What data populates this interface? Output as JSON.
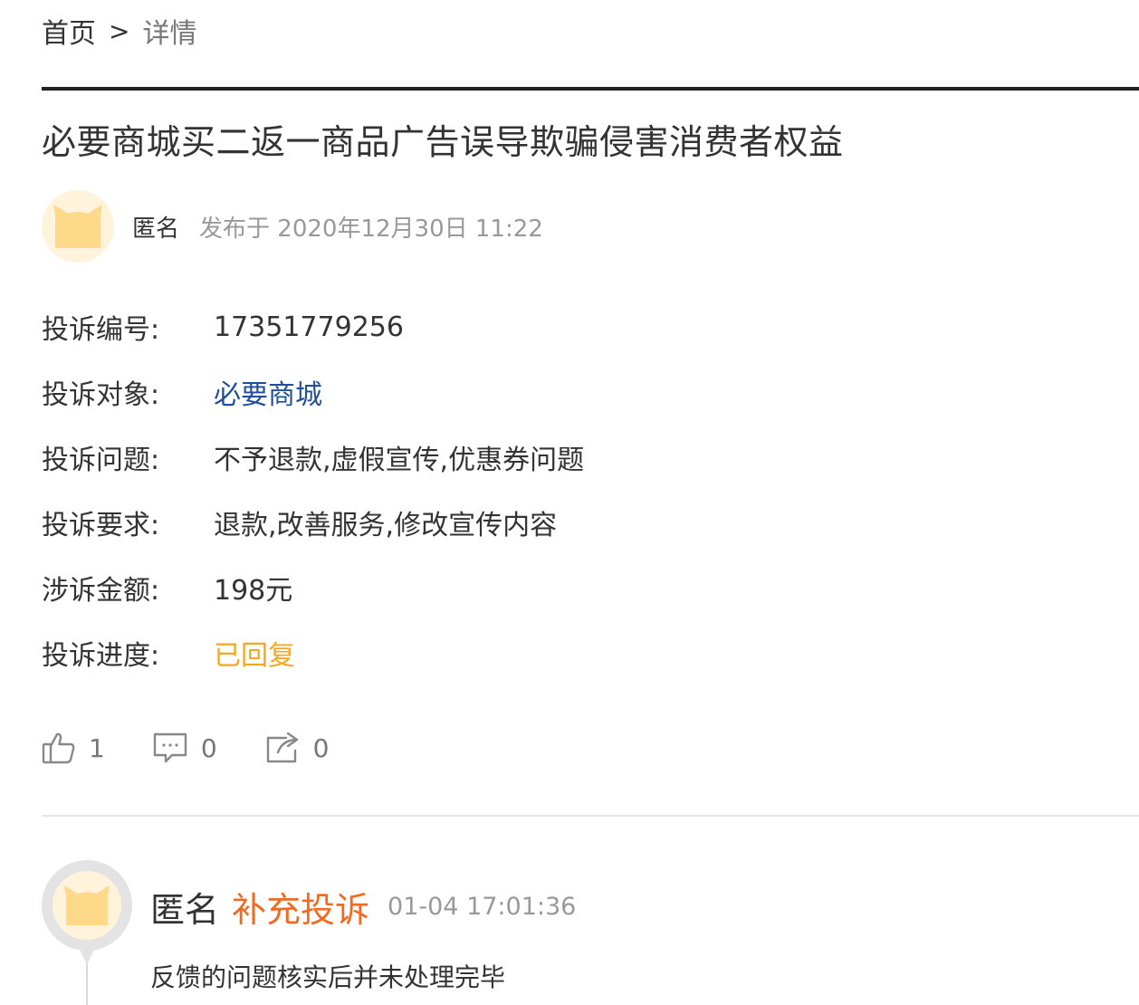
{
  "breadcrumb": {
    "home": "首页",
    "separator": ">",
    "current": "详情"
  },
  "complaint": {
    "title": "必要商城买二返一商品广告误导欺骗侵害消费者权益",
    "author": "匿名",
    "published": "发布于 2020年12月30日 11:22"
  },
  "fields": [
    {
      "label": "投诉编号:",
      "value": "17351779256"
    },
    {
      "label": "投诉对象:",
      "value": "必要商城"
    },
    {
      "label": "投诉问题:",
      "value": "不予退款,虚假宣传,优惠券问题"
    },
    {
      "label": "投诉要求:",
      "value": "退款,改善服务,修改宣传内容"
    },
    {
      "label": "涉诉金额:",
      "value": "198元"
    },
    {
      "label": "投诉进度:",
      "value": "已回复"
    }
  ],
  "actions": {
    "like_icon": "thumbs-up-icon",
    "likes": "1",
    "comment_icon": "comment-icon",
    "comments": "0",
    "share_icon": "share-icon",
    "shares": "0"
  },
  "reply": {
    "author": "匿名",
    "type": "补充投诉",
    "time": "01-04 17:01:36",
    "content": "反馈的问题核实后并未处理完毕"
  },
  "colors": {
    "link": "#1f4f9a",
    "status": "#f5a623",
    "reply_type": "#f26a21",
    "avatar_bg": "#fff3dc",
    "avatar_cat": "#ffd98a"
  }
}
